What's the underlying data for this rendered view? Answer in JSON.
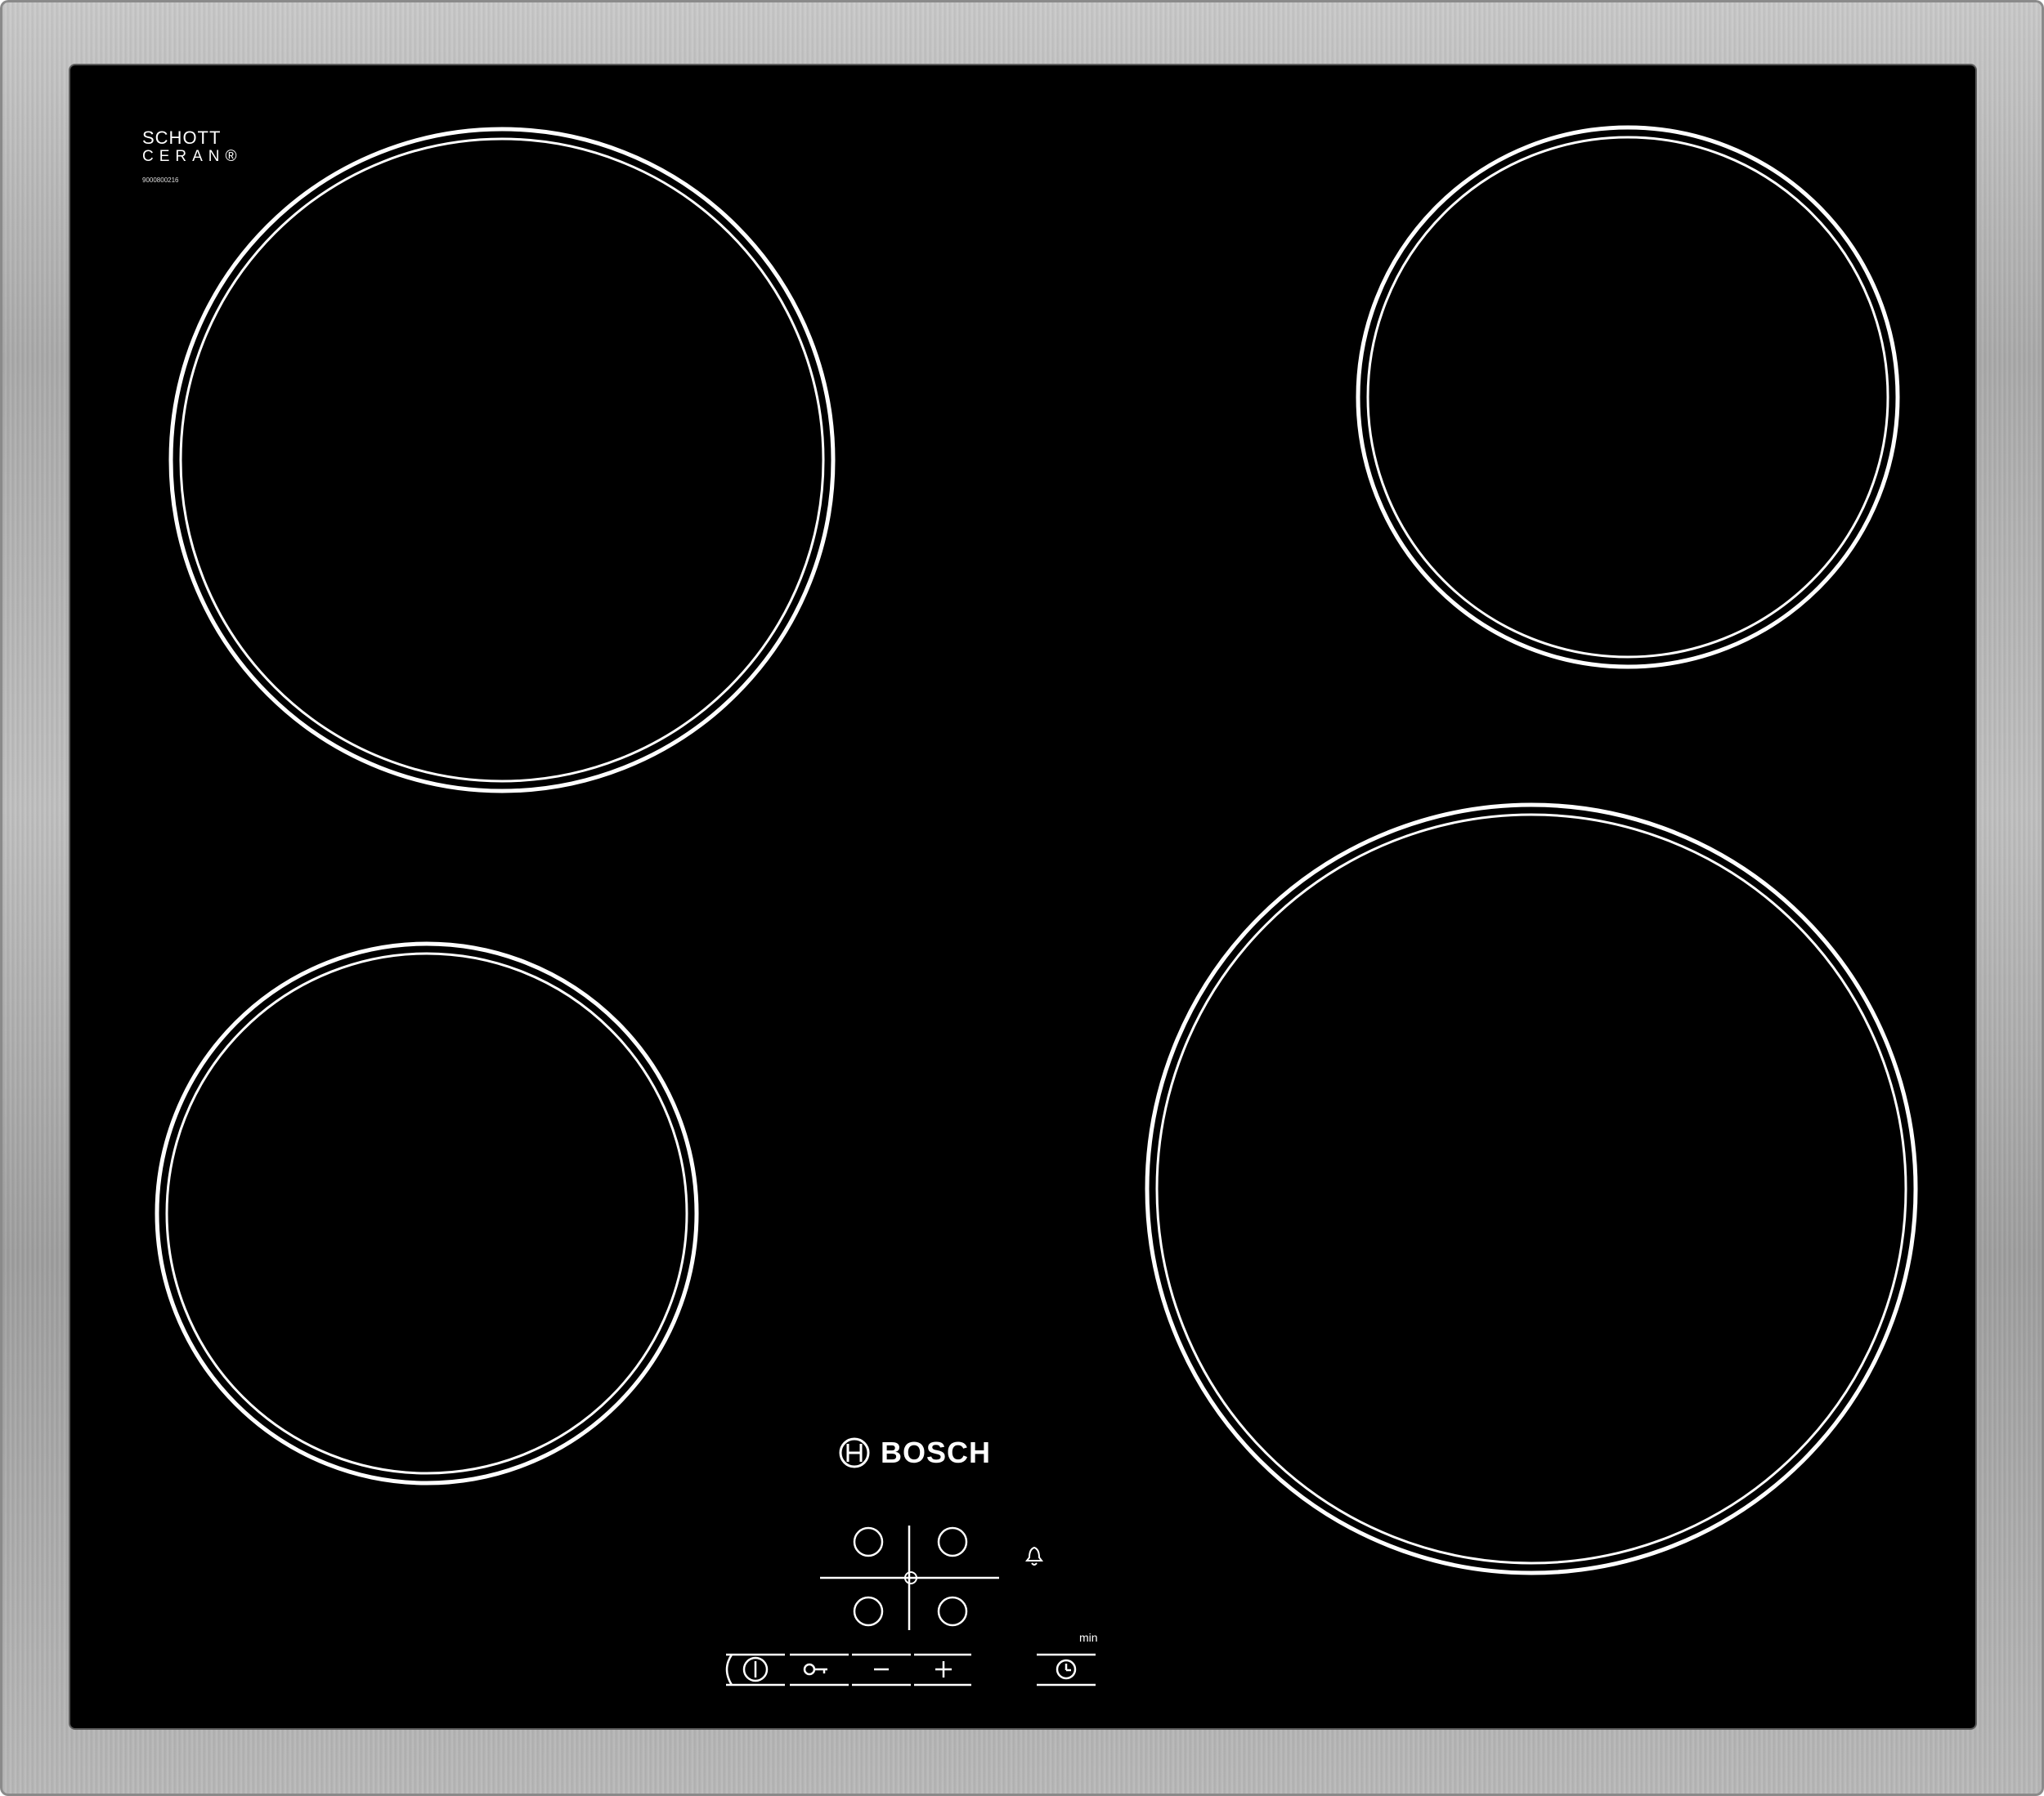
{
  "appliance": {
    "brand": "BOSCH",
    "glass_brand_line1": "SCHOTT",
    "glass_brand_line2": "CERAN®",
    "serial_code": "9000800216"
  },
  "controls": {
    "timer_unit_label": "min",
    "icons": [
      "power-icon",
      "child-lock-key-icon",
      "minus-icon",
      "plus-icon",
      "timer-clock-icon",
      "alarm-bell-icon",
      "zone-selector-icon"
    ]
  },
  "colors": {
    "glass": "#000000",
    "frame": "#b3b3b3",
    "markings": "#ffffff"
  }
}
